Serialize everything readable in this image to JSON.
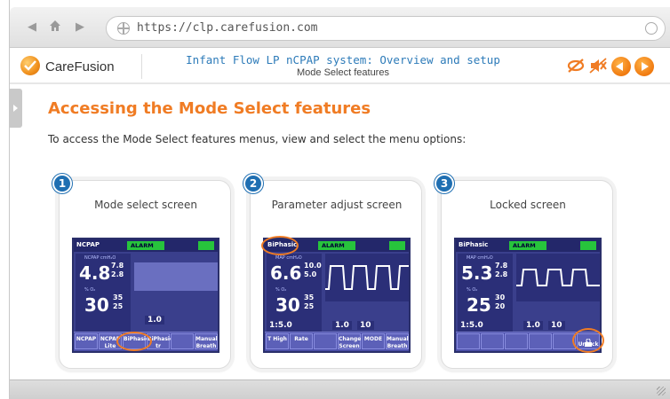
{
  "browser": {
    "url": "https://clp.carefusion.com"
  },
  "header": {
    "brand": "CareFusion",
    "course_title": "Infant Flow LP nCPAP system: Overview and setup",
    "course_subtitle": "Mode Select features"
  },
  "content": {
    "title": "Accessing the Mode Select features",
    "instruction": "To access the Mode Select features menus, view and select the menu options:"
  },
  "steps": [
    {
      "number": "1",
      "title": "Mode select screen",
      "screen": {
        "mode": "NCPAP",
        "alarm": "ALARM",
        "pressure_label": "NCPAP cmH₂O",
        "pressure": "4.8",
        "p_hi": "7.8",
        "p_lo": "2.8",
        "o2_label": "% O₂",
        "o2": "30",
        "o2_hi": "35",
        "o2_lo": "25",
        "t_high": "1.0",
        "buttons": [
          "NCPAP",
          "NCPAP Lite",
          "BiPhasic",
          "BiPhasic tr",
          "",
          "Manual Breath"
        ]
      }
    },
    {
      "number": "2",
      "title": "Parameter adjust screen",
      "screen": {
        "mode": "BiPhasic",
        "alarm": "ALARM",
        "pressure_label": "MAP cmH₂O",
        "pressure": "6.6",
        "p_hi": "10.0",
        "p_lo": "5.0",
        "o2_label": "% O₂",
        "o2": "30",
        "o2_hi": "35",
        "o2_lo": "25",
        "ie": "1:5.0",
        "t_high": "1.0",
        "rate": "10",
        "buttons": [
          "T High",
          "Rate",
          "",
          "Change Screen",
          "MODE",
          "Manual Breath"
        ]
      }
    },
    {
      "number": "3",
      "title": "Locked screen",
      "screen": {
        "mode": "BiPhasic",
        "alarm": "ALARM",
        "pressure_label": "MAP cmH₂O",
        "pressure": "5.3",
        "p_hi": "7.8",
        "p_lo": "2.8",
        "o2_label": "% O₂",
        "o2": "25",
        "o2_hi": "30",
        "o2_lo": "20",
        "ie": "1:5.0",
        "t_high": "1.0",
        "rate": "10",
        "buttons": [
          "",
          "",
          "",
          "",
          "",
          "Unlock"
        ]
      }
    }
  ],
  "colors": {
    "accent": "#f07c24",
    "title_blue": "#2d7bb9",
    "badge_blue": "#1f6fb2",
    "device_blue": "#3a3f8c",
    "alarm_green": "#27c43c"
  },
  "icons": {
    "back": "arrow-left-icon",
    "home": "home-icon",
    "forward": "arrow-right-icon",
    "secure": "globe-icon",
    "reload": "reload-icon",
    "no_captions": "captions-off-icon",
    "mute": "mute-icon",
    "prev": "prev-icon",
    "next": "next-icon"
  }
}
